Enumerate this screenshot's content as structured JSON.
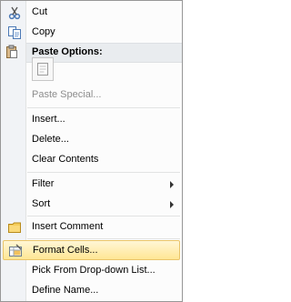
{
  "menu": {
    "items": [
      {
        "label": "Cut",
        "icon": "scissors-icon"
      },
      {
        "label": "Copy",
        "icon": "copy-icon"
      },
      {
        "section": "Paste Options:"
      },
      {
        "label": "Paste Special...",
        "disabled": true
      },
      {
        "label": "Insert..."
      },
      {
        "label": "Delete..."
      },
      {
        "label": "Clear Contents"
      },
      {
        "label": "Filter",
        "submenu": true
      },
      {
        "label": "Sort",
        "submenu": true
      },
      {
        "label": "Insert Comment",
        "icon": "comment-icon"
      },
      {
        "label": "Format Cells...",
        "icon": "format-cells-icon",
        "highlighted": true
      },
      {
        "label": "Pick From Drop-down List..."
      },
      {
        "label": "Define Name..."
      }
    ],
    "paste_option_icon": "paste-values-icon"
  },
  "colors": {
    "highlight": "#ffe694",
    "highlight_border": "#e9c46a",
    "disabled_text": "#8d8d8d"
  }
}
